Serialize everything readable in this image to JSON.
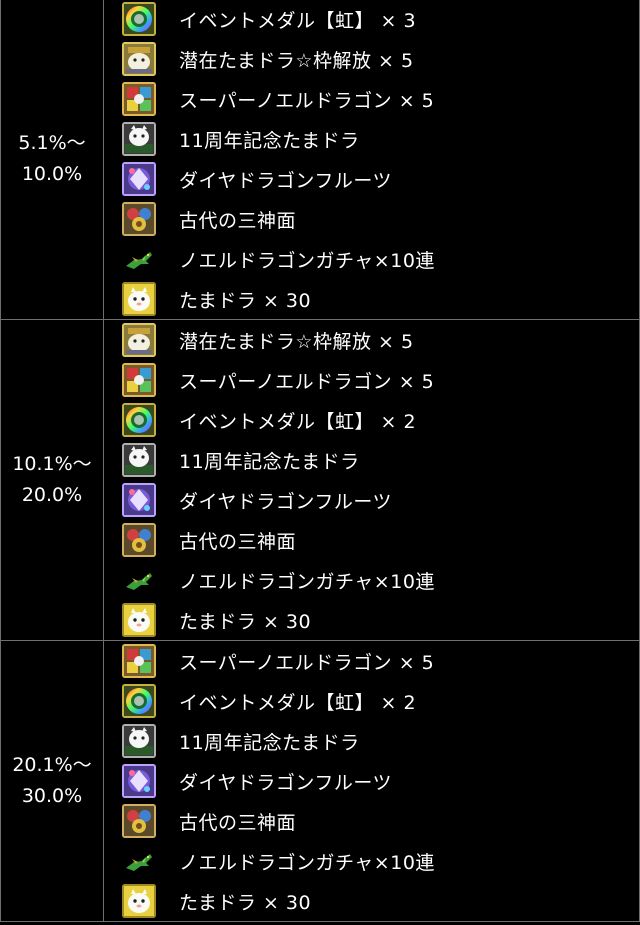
{
  "tiers": [
    {
      "range_line1": "5.1%〜",
      "range_line2": "10.0%",
      "items": [
        {
          "icon": "rainbow-medal-icon",
          "label": "イベントメダル【虹】 × 3"
        },
        {
          "icon": "latent-tamadra-icon",
          "label": "潜在たまドラ☆枠解放 × 5"
        },
        {
          "icon": "super-noel-dragon-icon",
          "label": "スーパーノエルドラゴン × 5"
        },
        {
          "icon": "anniversary-tamadra-icon",
          "label": "11周年記念たまドラ"
        },
        {
          "icon": "diamond-dragon-fruit-icon",
          "label": "ダイヤドラゴンフルーツ"
        },
        {
          "icon": "ancient-mask-icon",
          "label": "古代の三神面"
        },
        {
          "icon": "noel-gacha-dragon-icon",
          "label": "ノエルドラゴンガチャ×10連"
        },
        {
          "icon": "tamadra-icon",
          "label": "たまドラ × 30"
        }
      ]
    },
    {
      "range_line1": "10.1%〜",
      "range_line2": "20.0%",
      "items": [
        {
          "icon": "latent-tamadra-icon",
          "label": "潜在たまドラ☆枠解放 × 5"
        },
        {
          "icon": "super-noel-dragon-icon",
          "label": "スーパーノエルドラゴン × 5"
        },
        {
          "icon": "rainbow-medal-icon",
          "label": "イベントメダル【虹】 × 2"
        },
        {
          "icon": "anniversary-tamadra-icon",
          "label": "11周年記念たまドラ"
        },
        {
          "icon": "diamond-dragon-fruit-icon",
          "label": "ダイヤドラゴンフルーツ"
        },
        {
          "icon": "ancient-mask-icon",
          "label": "古代の三神面"
        },
        {
          "icon": "noel-gacha-dragon-icon",
          "label": "ノエルドラゴンガチャ×10連"
        },
        {
          "icon": "tamadra-icon",
          "label": "たまドラ × 30"
        }
      ]
    },
    {
      "range_line1": "20.1%〜",
      "range_line2": "30.0%",
      "items": [
        {
          "icon": "super-noel-dragon-icon",
          "label": "スーパーノエルドラゴン × 5"
        },
        {
          "icon": "rainbow-medal-icon",
          "label": "イベントメダル【虹】 × 2"
        },
        {
          "icon": "anniversary-tamadra-icon",
          "label": "11周年記念たまドラ"
        },
        {
          "icon": "diamond-dragon-fruit-icon",
          "label": "ダイヤドラゴンフルーツ"
        },
        {
          "icon": "ancient-mask-icon",
          "label": "古代の三神面"
        },
        {
          "icon": "noel-gacha-dragon-icon",
          "label": "ノエルドラゴンガチャ×10連"
        },
        {
          "icon": "tamadra-icon",
          "label": "たまドラ × 30"
        }
      ]
    }
  ]
}
